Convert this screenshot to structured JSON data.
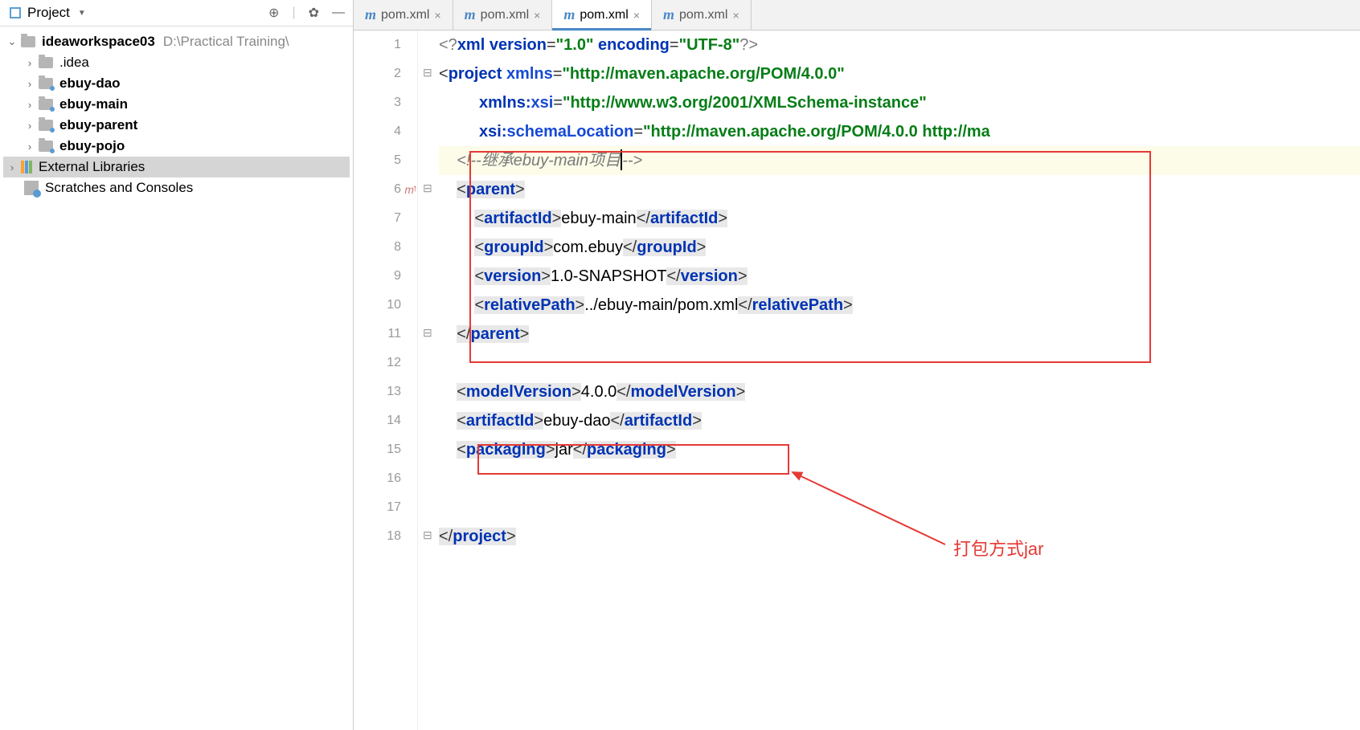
{
  "sidebar": {
    "title": "Project",
    "root": {
      "name": "ideaworkspace03",
      "path": "D:\\Practical Training\\"
    },
    "folders": [
      ".idea",
      "ebuy-dao",
      "ebuy-main",
      "ebuy-parent",
      "ebuy-pojo"
    ],
    "external": "External Libraries",
    "scratches": "Scratches and Consoles"
  },
  "tabs": [
    {
      "label": "pom.xml",
      "active": false
    },
    {
      "label": "pom.xml",
      "active": false
    },
    {
      "label": "pom.xml",
      "active": true
    },
    {
      "label": "pom.xml",
      "active": false
    }
  ],
  "code": {
    "xml_version": "1.0",
    "xml_encoding": "UTF-8",
    "ns": "http://maven.apache.org/POM/4.0.0",
    "ns_xsi": "http://www.w3.org/2001/XMLSchema-instance",
    "schema_loc": "http://maven.apache.org/POM/4.0.0 http://ma",
    "comment": "继承ebuy-main项目",
    "parent_artifact": "ebuy-main",
    "parent_group": "com.ebuy",
    "parent_version": "1.0-SNAPSHOT",
    "parent_relpath": "../ebuy-main/pom.xml",
    "model_version": "4.0.0",
    "artifact": "ebuy-dao",
    "packaging": "jar"
  },
  "annotation": "打包方式jar",
  "line_numbers": [
    "1",
    "2",
    "3",
    "4",
    "5",
    "6",
    "7",
    "8",
    "9",
    "10",
    "11",
    "12",
    "13",
    "14",
    "15",
    "16",
    "17",
    "18"
  ]
}
